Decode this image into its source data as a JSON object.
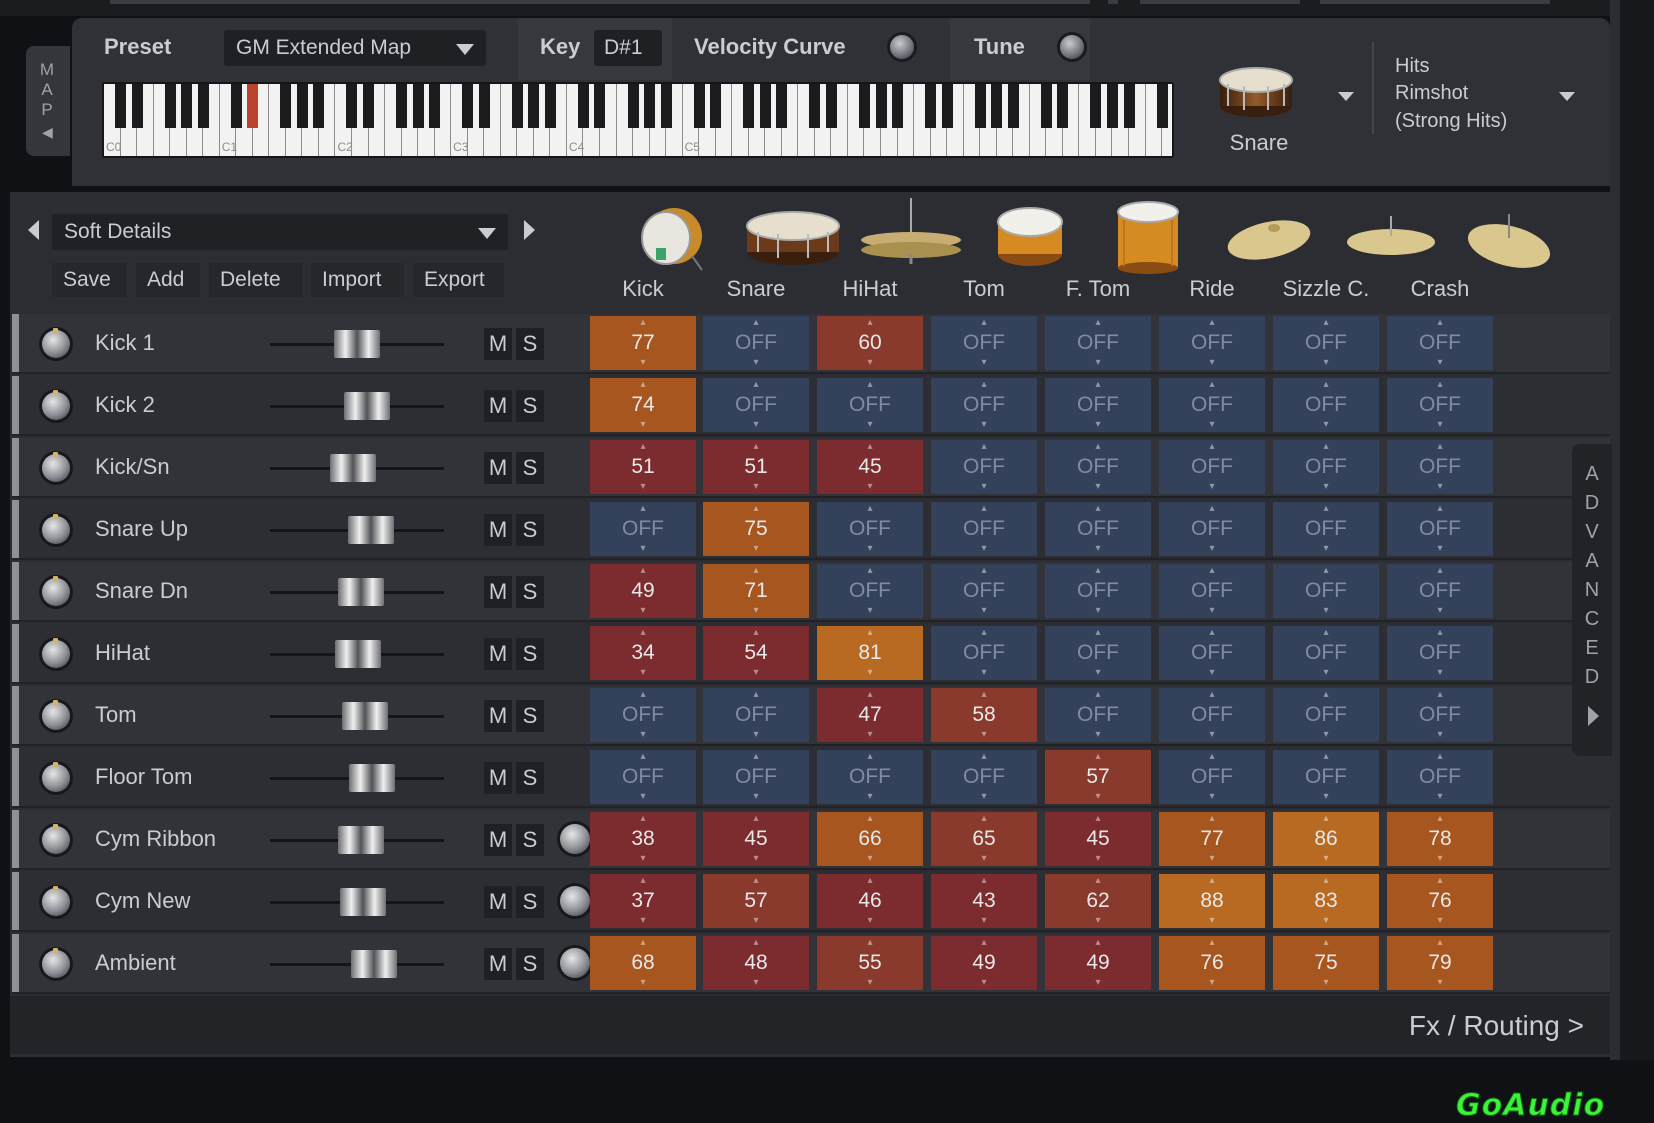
{
  "map": {
    "tab_label": "MAP",
    "preset_label": "Preset",
    "preset_value": "GM Extended Map",
    "key_label": "Key",
    "key_value": "D#1",
    "velocity_label": "Velocity Curve",
    "tune_label": "Tune",
    "octave_labels": [
      "C0",
      "C1",
      "C2",
      "C3",
      "C4",
      "C5"
    ],
    "active_key": "D#1",
    "kit_piece": "Snare",
    "articulation": [
      "Hits",
      "Rimshot",
      "(Strong Hits)"
    ]
  },
  "mixer": {
    "preset_value": "Soft Details",
    "buttons": [
      "Save",
      "Add",
      "Delete",
      "Import",
      "Export"
    ],
    "columns": [
      "Kick",
      "Snare",
      "HiHat",
      "Tom",
      "F. Tom",
      "Ride",
      "Sizzle C.",
      "Crash"
    ],
    "mute_label": "M",
    "solo_label": "S",
    "rows": [
      {
        "name": "Kick 1",
        "fader": 0.5,
        "aux": false,
        "cells": [
          "77",
          "OFF",
          "60",
          "OFF",
          "OFF",
          "OFF",
          "OFF",
          "OFF"
        ]
      },
      {
        "name": "Kick 2",
        "fader": 0.58,
        "aux": false,
        "cells": [
          "74",
          "OFF",
          "OFF",
          "OFF",
          "OFF",
          "OFF",
          "OFF",
          "OFF"
        ]
      },
      {
        "name": "Kick/Sn",
        "fader": 0.47,
        "aux": false,
        "cells": [
          "51",
          "51",
          "45",
          "OFF",
          "OFF",
          "OFF",
          "OFF",
          "OFF"
        ]
      },
      {
        "name": "Snare Up",
        "fader": 0.61,
        "aux": false,
        "cells": [
          "OFF",
          "75",
          "OFF",
          "OFF",
          "OFF",
          "OFF",
          "OFF",
          "OFF"
        ]
      },
      {
        "name": "Snare Dn",
        "fader": 0.53,
        "aux": false,
        "cells": [
          "49",
          "71",
          "OFF",
          "OFF",
          "OFF",
          "OFF",
          "OFF",
          "OFF"
        ]
      },
      {
        "name": "HiHat",
        "fader": 0.51,
        "aux": false,
        "cells": [
          "34",
          "54",
          "81",
          "OFF",
          "OFF",
          "OFF",
          "OFF",
          "OFF"
        ]
      },
      {
        "name": "Tom",
        "fader": 0.56,
        "aux": false,
        "cells": [
          "OFF",
          "OFF",
          "47",
          "58",
          "OFF",
          "OFF",
          "OFF",
          "OFF"
        ]
      },
      {
        "name": "Floor Tom",
        "fader": 0.62,
        "aux": false,
        "cells": [
          "OFF",
          "OFF",
          "OFF",
          "OFF",
          "57",
          "OFF",
          "OFF",
          "OFF"
        ]
      },
      {
        "name": "Cym Ribbon",
        "fader": 0.53,
        "aux": true,
        "cells": [
          "38",
          "45",
          "66",
          "65",
          "45",
          "77",
          "86",
          "78"
        ]
      },
      {
        "name": "Cym New",
        "fader": 0.55,
        "aux": true,
        "cells": [
          "37",
          "57",
          "46",
          "43",
          "62",
          "88",
          "83",
          "76"
        ]
      },
      {
        "name": "Ambient",
        "fader": 0.63,
        "aux": true,
        "cells": [
          "68",
          "48",
          "55",
          "49",
          "49",
          "76",
          "75",
          "79"
        ]
      }
    ],
    "advanced_label": "ADVANCED",
    "footer_label": "Fx / Routing  >"
  },
  "colors": {
    "off": "#34415a",
    "red": "#7c2b2f",
    "red_mid": "#8a3a2d",
    "orange": "#a7561f",
    "orange_hot": "#b86a22",
    "accent_key": "#b9432d"
  },
  "watermark": "GoAudio"
}
